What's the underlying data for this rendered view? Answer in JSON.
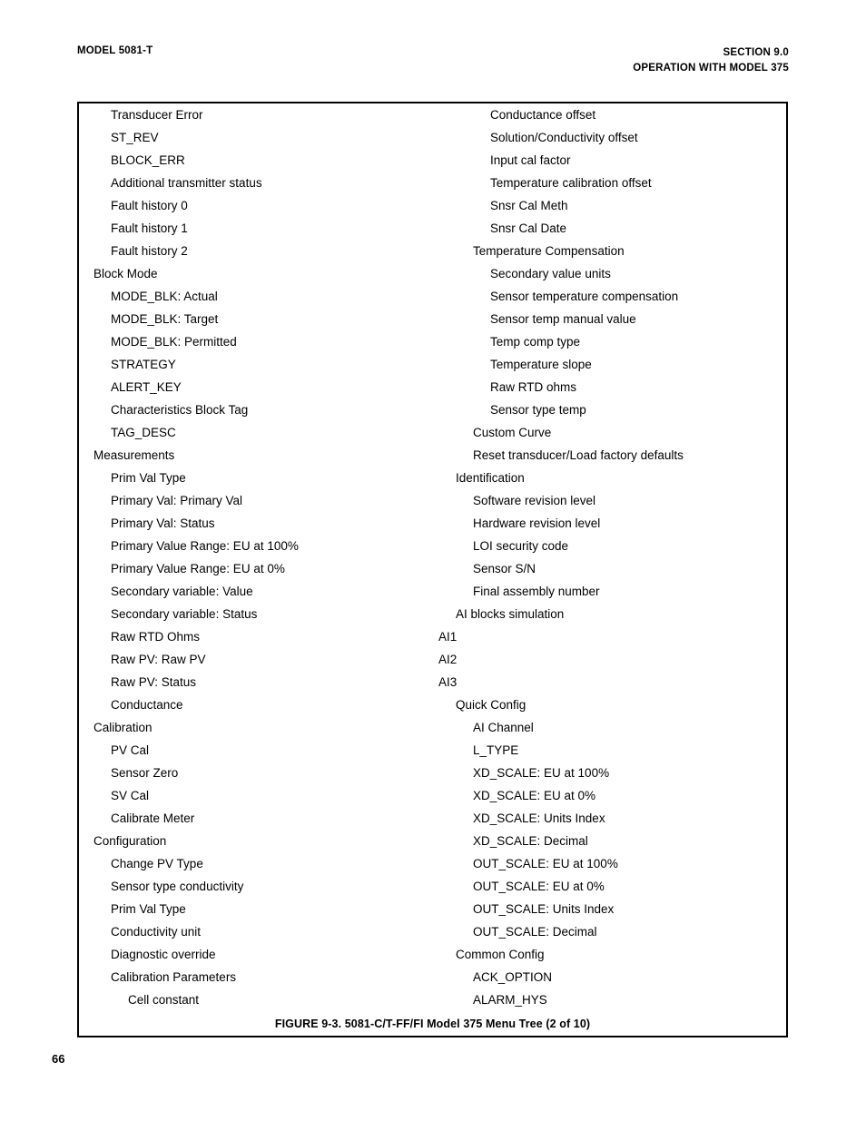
{
  "header": {
    "left": "MODEL 5081-T",
    "right_line1": "SECTION 9.0",
    "right_line2": "OPERATION WITH MODEL 375"
  },
  "figure": {
    "caption": "FIGURE 9-3. 5081-C/T-FF/FI Model 375 Menu Tree (2 of 10)",
    "left_column": [
      {
        "label": "Transducer Error",
        "level": 1
      },
      {
        "label": "ST_REV",
        "level": 1
      },
      {
        "label": "BLOCK_ERR",
        "level": 1
      },
      {
        "label": "Additional transmitter status",
        "level": 1
      },
      {
        "label": "Fault history 0",
        "level": 1
      },
      {
        "label": "Fault history 1",
        "level": 1
      },
      {
        "label": "Fault history 2",
        "level": 1
      },
      {
        "label": "Block Mode",
        "level": 0
      },
      {
        "label": "MODE_BLK: Actual",
        "level": 1
      },
      {
        "label": "MODE_BLK: Target",
        "level": 1
      },
      {
        "label": "MODE_BLK: Permitted",
        "level": 1
      },
      {
        "label": "STRATEGY",
        "level": 1
      },
      {
        "label": "ALERT_KEY",
        "level": 1
      },
      {
        "label": "Characteristics Block Tag",
        "level": 1
      },
      {
        "label": "TAG_DESC",
        "level": 1
      },
      {
        "label": "Measurements",
        "level": 0
      },
      {
        "label": "Prim Val Type",
        "level": 1
      },
      {
        "label": "Primary Val: Primary Val",
        "level": 1
      },
      {
        "label": "Primary Val: Status",
        "level": 1
      },
      {
        "label": "Primary Value Range: EU at 100%",
        "level": 1
      },
      {
        "label": "Primary Value Range: EU at 0%",
        "level": 1
      },
      {
        "label": "Secondary variable: Value",
        "level": 1
      },
      {
        "label": "Secondary variable: Status",
        "level": 1
      },
      {
        "label": "Raw RTD Ohms",
        "level": 1
      },
      {
        "label": "Raw PV: Raw PV",
        "level": 1
      },
      {
        "label": "Raw PV: Status",
        "level": 1
      },
      {
        "label": "Conductance",
        "level": 1
      },
      {
        "label": "Calibration",
        "level": 0
      },
      {
        "label": "PV Cal",
        "level": 1
      },
      {
        "label": "Sensor Zero",
        "level": 1
      },
      {
        "label": "SV Cal",
        "level": 1
      },
      {
        "label": "Calibrate Meter",
        "level": 1
      },
      {
        "label": "Configuration",
        "level": 0
      },
      {
        "label": "Change PV Type",
        "level": 1
      },
      {
        "label": "Sensor type conductivity",
        "level": 1
      },
      {
        "label": "Prim Val Type",
        "level": 1
      },
      {
        "label": "Conductivity unit",
        "level": 1
      },
      {
        "label": "Diagnostic override",
        "level": 1
      },
      {
        "label": "Calibration Parameters",
        "level": 1
      },
      {
        "label": "Cell constant",
        "level": 2
      }
    ],
    "right_column": [
      {
        "label": "Conductance offset",
        "level": 3
      },
      {
        "label": "Solution/Conductivity offset",
        "level": 3
      },
      {
        "label": "Input cal factor",
        "level": 3
      },
      {
        "label": "Temperature calibration offset",
        "level": 3
      },
      {
        "label": "Snsr Cal Meth",
        "level": 3
      },
      {
        "label": "Snsr Cal Date",
        "level": 3
      },
      {
        "label": "Temperature Compensation",
        "level": 2
      },
      {
        "label": "Secondary value units",
        "level": 3
      },
      {
        "label": "Sensor temperature compensation",
        "level": 3
      },
      {
        "label": "Sensor temp manual value",
        "level": 3
      },
      {
        "label": "Temp comp type",
        "level": 3
      },
      {
        "label": "Temperature slope",
        "level": 3
      },
      {
        "label": "Raw RTD ohms",
        "level": 3
      },
      {
        "label": "Sensor type temp",
        "level": 3
      },
      {
        "label": "Custom Curve",
        "level": 2
      },
      {
        "label": "Reset transducer/Load factory defaults",
        "level": 2
      },
      {
        "label": "Identification",
        "level": 1
      },
      {
        "label": "Software revision level",
        "level": 2
      },
      {
        "label": "Hardware revision level",
        "level": 2
      },
      {
        "label": "LOI security code",
        "level": 2
      },
      {
        "label": "Sensor S/N",
        "level": 2
      },
      {
        "label": "Final assembly number",
        "level": 2
      },
      {
        "label": "AI blocks simulation",
        "level": 1
      },
      {
        "label": "AI1",
        "level": 0
      },
      {
        "label": "AI2",
        "level": 0
      },
      {
        "label": "AI3",
        "level": 0
      },
      {
        "label": "Quick Config",
        "level": 1
      },
      {
        "label": "AI Channel",
        "level": 2
      },
      {
        "label": "L_TYPE",
        "level": 2
      },
      {
        "label": "XD_SCALE: EU at 100%",
        "level": 2
      },
      {
        "label": "XD_SCALE: EU at 0%",
        "level": 2
      },
      {
        "label": "XD_SCALE: Units Index",
        "level": 2
      },
      {
        "label": "XD_SCALE: Decimal",
        "level": 2
      },
      {
        "label": "OUT_SCALE: EU at 100%",
        "level": 2
      },
      {
        "label": "OUT_SCALE: EU at 0%",
        "level": 2
      },
      {
        "label": "OUT_SCALE: Units Index",
        "level": 2
      },
      {
        "label": "OUT_SCALE: Decimal",
        "level": 2
      },
      {
        "label": "Common Config",
        "level": 1
      },
      {
        "label": "ACK_OPTION",
        "level": 2
      },
      {
        "label": "ALARM_HYS",
        "level": 2
      }
    ]
  },
  "page_number": "66"
}
